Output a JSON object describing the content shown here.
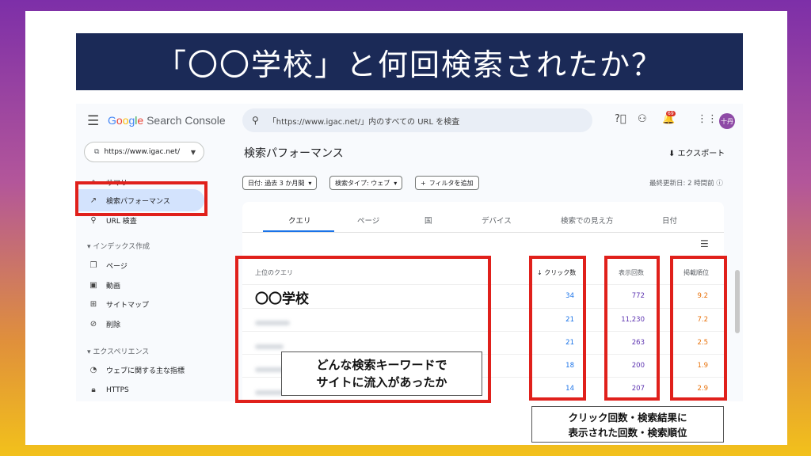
{
  "slide": {
    "title": "「〇〇学校」と何回検索されたか？",
    "callout_left": [
      "どんな検索キーワードで",
      "サイトに流入があったか"
    ],
    "callout_right": [
      "クリック回数・検索結果に",
      "表示された回数・検索順位"
    ]
  },
  "app": {
    "logo": "Google Search Console",
    "search_placeholder": "「https://www.igac.net/」内のすべての URL を検査",
    "notification_count": "69",
    "avatar_initials": "十丹",
    "property": "https://www.igac.net/"
  },
  "sidebar": {
    "items": [
      {
        "label": "サマリー",
        "icon": "home-icon"
      },
      {
        "label": "検索パフォーマンス",
        "icon": "trending-icon"
      },
      {
        "label": "URL 検査",
        "icon": "search-icon"
      }
    ],
    "index_section": "インデックス作成",
    "index_items": [
      {
        "label": "ページ",
        "icon": "pages-icon"
      },
      {
        "label": "動画",
        "icon": "video-icon"
      },
      {
        "label": "サイトマップ",
        "icon": "sitemap-icon"
      },
      {
        "label": "削除",
        "icon": "removal-icon"
      }
    ],
    "experience_section": "エクスペリエンス",
    "experience_items": [
      {
        "label": "ウェブに関する主な指標",
        "icon": "gauge-icon"
      },
      {
        "label": "HTTPS",
        "icon": "lock-icon"
      }
    ]
  },
  "main": {
    "page_title": "検索パフォーマンス",
    "export_label": "エクスポート",
    "filters": [
      "日付: 過去 3 か月間",
      "検索タイプ: ウェブ",
      "フィルタを追加"
    ],
    "last_updated": "最終更新日: 2 時間前",
    "tabs": [
      "クエリ",
      "ページ",
      "国",
      "デバイス",
      "検索での見え方",
      "日付"
    ],
    "columns": {
      "query": "上位のクエリ",
      "clicks": "クリック数",
      "impressions": "表示回数",
      "position": "掲載順位"
    },
    "rows": [
      {
        "query": "〇〇学校",
        "clicks": "34",
        "impressions": "772",
        "position": "9.2"
      },
      {
        "query": "",
        "clicks": "21",
        "impressions": "11,230",
        "position": "7.2"
      },
      {
        "query": "",
        "clicks": "21",
        "impressions": "263",
        "position": "2.5"
      },
      {
        "query": "",
        "clicks": "18",
        "impressions": "200",
        "position": "1.9"
      },
      {
        "query": "",
        "clicks": "14",
        "impressions": "207",
        "position": "2.9"
      }
    ]
  },
  "colors": {
    "clicks": "#1a73e8",
    "impressions": "#5e35b1",
    "position": "#e8710a",
    "highlight": "#e0201b",
    "banner": "#1b2a57"
  }
}
